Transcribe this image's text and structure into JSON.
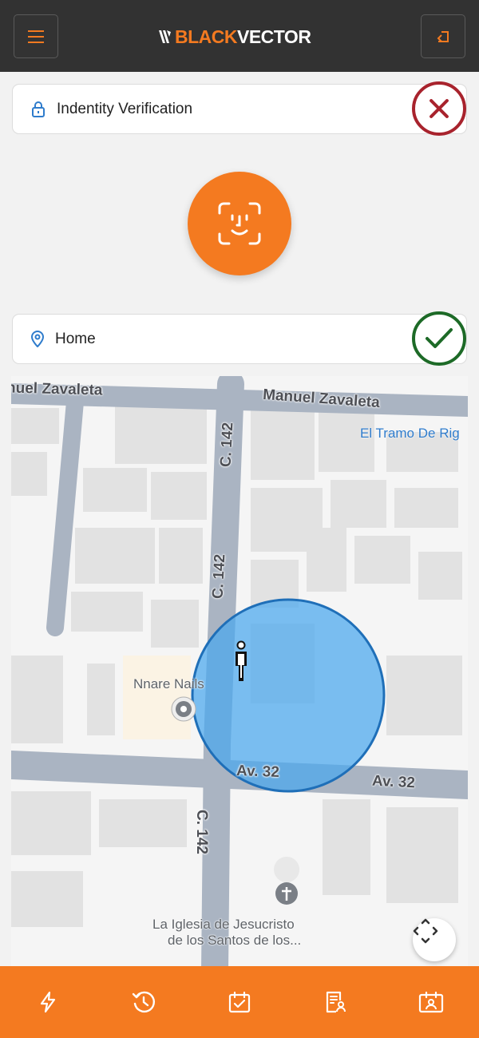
{
  "header": {
    "brand_part1": "BLACK",
    "brand_part2": "VECTOR",
    "menu_icon": "hamburger-menu-icon",
    "logout_icon": "back-arrow-icon"
  },
  "identity": {
    "label": "Indentity Verification",
    "icon": "lock-icon",
    "status": "failed",
    "status_icon": "x-mark-icon"
  },
  "face_scan": {
    "icon": "face-id-icon"
  },
  "location": {
    "label": "Home",
    "icon": "map-pin-icon",
    "status": "verified",
    "status_icon": "checkmark-icon"
  },
  "map": {
    "street_top_left": "nuel Zavaleta",
    "street_top_right": "Manuel Zavaleta",
    "street_c142_top": "C. 142",
    "street_c142_mid": "C. 142",
    "street_c142_bottom": "C. 142",
    "street_av32_inside": "Av. 32",
    "street_av32_right": "Av. 32",
    "poi_el_tramo": "El Tramo De Rig",
    "poi_nails": "Nnare Nails",
    "poi_church_line1": "La Iglesia de Jesucristo",
    "poi_church_line2": "de los Santos de los...",
    "recenter_icon": "recenter-icon"
  },
  "bottom_nav": [
    {
      "icon": "lightning-icon"
    },
    {
      "icon": "history-icon"
    },
    {
      "icon": "calendar-check-icon"
    },
    {
      "icon": "report-user-icon"
    },
    {
      "icon": "id-card-icon"
    }
  ],
  "colors": {
    "brand_orange": "#f47a20",
    "header_bg": "#323232",
    "fail_red": "#a8232d",
    "ok_green": "#1d6a27",
    "geofence_blue": "#4aa8ee"
  }
}
